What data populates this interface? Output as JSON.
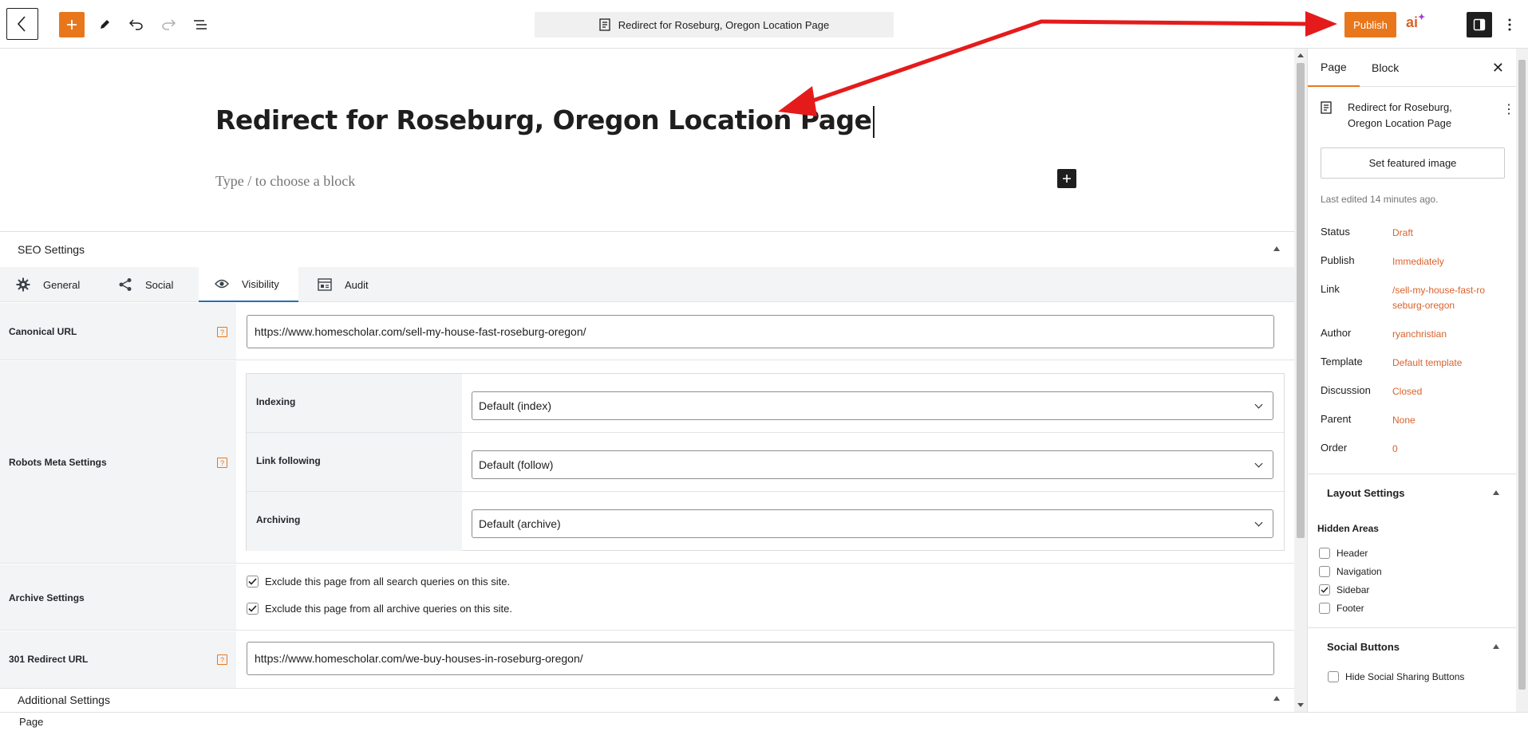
{
  "toolbar": {
    "doc_title": "Redirect for Roseburg, Oregon Location Page",
    "publish_label": "Publish",
    "ai_label": "ai",
    "icons": [
      "chevron-left-icon",
      "plus-icon",
      "pencil-icon",
      "undo-icon",
      "redo-icon",
      "list-view-icon",
      "document-icon",
      "settings-sidebar-icon",
      "more-vertical-icon"
    ]
  },
  "editor": {
    "title": "Redirect for Roseburg, Oregon Location Page",
    "placeholder": "Type / to choose a block"
  },
  "seo": {
    "header": "SEO Settings",
    "tabs": [
      {
        "label": "General",
        "icon": "gear-icon"
      },
      {
        "label": "Social",
        "icon": "share-icon"
      },
      {
        "label": "Visibility",
        "icon": "eye-icon"
      },
      {
        "label": "Audit",
        "icon": "audit-icon"
      }
    ],
    "active_tab": "Visibility",
    "canonical": {
      "label": "Canonical URL",
      "value": "https://www.homescholar.com/sell-my-house-fast-roseburg-oregon/"
    },
    "robots": {
      "label": "Robots Meta Settings",
      "rows": [
        {
          "label": "Indexing",
          "value": "Default (index)"
        },
        {
          "label": "Link following",
          "value": "Default (follow)"
        },
        {
          "label": "Archiving",
          "value": "Default (archive)"
        }
      ]
    },
    "archive": {
      "label": "Archive Settings",
      "options": [
        {
          "label": "Exclude this page from all search queries on this site.",
          "checked": true
        },
        {
          "label": "Exclude this page from all archive queries on this site.",
          "checked": true
        }
      ]
    },
    "redirect": {
      "label": "301 Redirect URL",
      "value": "https://www.homescholar.com/we-buy-houses-in-roseburg-oregon/"
    },
    "additional": "Additional Settings",
    "help_glyph": "?"
  },
  "footer": {
    "breadcrumb": "Page"
  },
  "sidebar": {
    "tabs": [
      "Page",
      "Block"
    ],
    "active_tab": "Page",
    "doc_title": "Redirect for Roseburg, Oregon Location Page",
    "featured_image": "Set featured image",
    "last_edited": "Last edited 14 minutes ago.",
    "meta": [
      {
        "key": "Status",
        "value": "Draft"
      },
      {
        "key": "Publish",
        "value": "Immediately"
      },
      {
        "key": "Link",
        "value": "/sell-my-house-fast-roseburg-oregon"
      },
      {
        "key": "Author",
        "value": "ryanchristian"
      },
      {
        "key": "Template",
        "value": "Default template"
      },
      {
        "key": "Discussion",
        "value": "Closed"
      },
      {
        "key": "Parent",
        "value": "None"
      },
      {
        "key": "Order",
        "value": "0"
      }
    ],
    "layout": {
      "title": "Layout Settings",
      "hidden_areas_label": "Hidden Areas",
      "areas": [
        {
          "label": "Header",
          "checked": false
        },
        {
          "label": "Navigation",
          "checked": false
        },
        {
          "label": "Sidebar",
          "checked": true
        },
        {
          "label": "Footer",
          "checked": false
        }
      ]
    },
    "social": {
      "title": "Social Buttons",
      "option": {
        "label": "Hide Social Sharing Buttons",
        "checked": false
      }
    }
  },
  "colors": {
    "accent": "#e8771c",
    "link": "#d9622b",
    "annotation": "#e51b1b",
    "tab_active": "#2271b1"
  }
}
